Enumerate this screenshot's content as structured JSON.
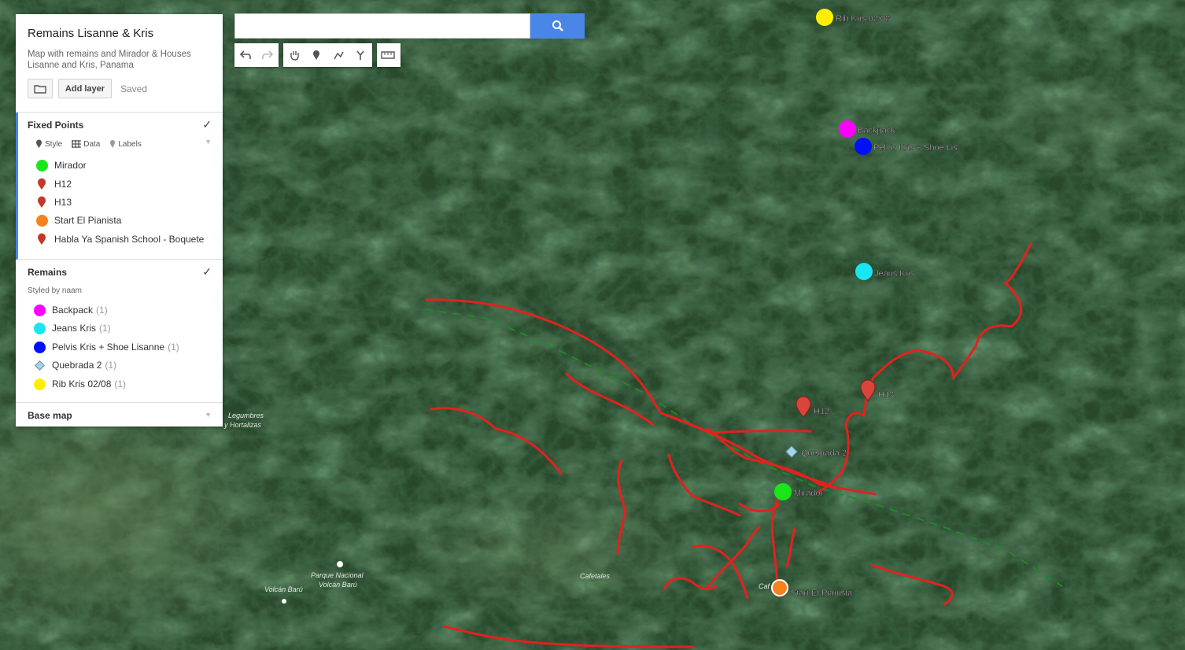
{
  "panel": {
    "title": "Remains Lisanne & Kris",
    "description": "Map with remains and Mirador & Houses Lisanne and Kris, Panama",
    "add_layer_label": "Add layer",
    "saved_label": "Saved"
  },
  "layers": [
    {
      "title": "Fixed Points",
      "tools": {
        "style": "Style",
        "data": "Data",
        "labels": "Labels"
      },
      "items": [
        {
          "label": "Mirador",
          "icon": "green-circle-icon",
          "color": "#19e619"
        },
        {
          "label": "H12",
          "icon": "red-pin-icon",
          "color": "#c0392b"
        },
        {
          "label": "H13",
          "icon": "red-pin-icon",
          "color": "#c0392b"
        },
        {
          "label": "Start El Pianista",
          "icon": "orange-circle-icon",
          "color": "#f5821f"
        },
        {
          "label": "Habla Ya Spanish School - Boquete",
          "icon": "red-pin-icon",
          "color": "#c0392b"
        }
      ]
    },
    {
      "title": "Remains",
      "subtitle": "Styled by naam",
      "items": [
        {
          "label": "Backpack",
          "count": "(1)",
          "icon": "magenta-circle-icon",
          "color": "#ff00ff"
        },
        {
          "label": "Jeans Kris",
          "count": "(1)",
          "icon": "cyan-circle-icon",
          "color": "#19e6f0"
        },
        {
          "label": "Pelvis Kris + Shoe Lisanne",
          "count": "(1)",
          "icon": "blue-circle-icon",
          "color": "#0010ff"
        },
        {
          "label": "Quebrada 2",
          "count": "(1)",
          "icon": "diamond-icon",
          "color": "#a9d3ea"
        },
        {
          "label": "Rib Kris 02/08",
          "count": "(1)",
          "icon": "yellow-circle-icon",
          "color": "#ffee00"
        }
      ]
    },
    {
      "title": "Base map"
    }
  ],
  "map_markers": {
    "rib": "Rib Kris 02/08",
    "backpack": "Backpack",
    "pelvis": "Pelvis Kris + Shoe Lis...",
    "jeans": "Jeans Kris",
    "h13": "H13",
    "h12": "H12",
    "quebrada": "Quebrada 2",
    "mirador": "Mirador",
    "start": "Start El Pianista"
  },
  "map_labels": {
    "legumbres": "Legumbres",
    "hortalizas": "y Hortalizas",
    "parque1": "Parque Nacional",
    "parque2": "Volcán Barú",
    "volcan": "Volcán Barú",
    "cafetales": "Cafetales",
    "caf": "Caf"
  }
}
